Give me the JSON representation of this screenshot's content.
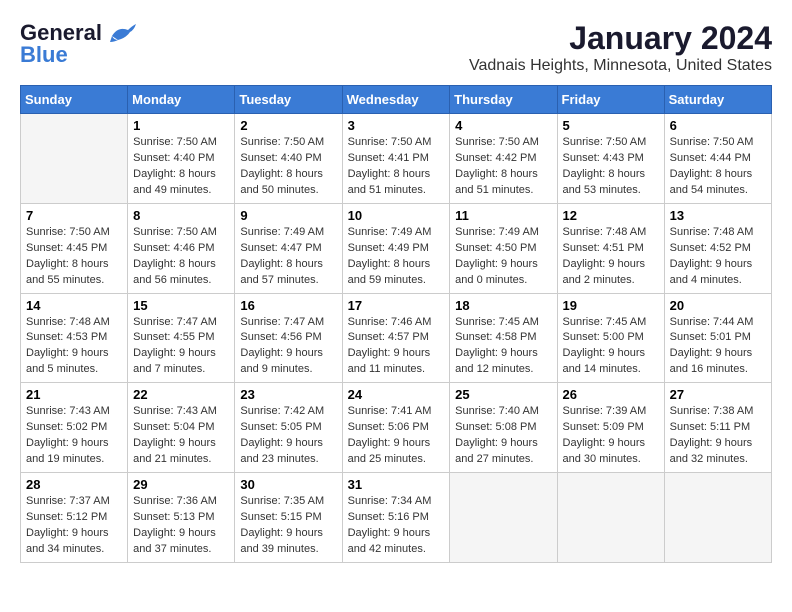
{
  "header": {
    "logo": {
      "part1": "General",
      "part2": "Blue"
    },
    "month": "January 2024",
    "location": "Vadnais Heights, Minnesota, United States"
  },
  "weekdays": [
    "Sunday",
    "Monday",
    "Tuesday",
    "Wednesday",
    "Thursday",
    "Friday",
    "Saturday"
  ],
  "weeks": [
    [
      {
        "day": "",
        "empty": true
      },
      {
        "day": "1",
        "sunrise": "Sunrise: 7:50 AM",
        "sunset": "Sunset: 4:40 PM",
        "daylight": "Daylight: 8 hours and 49 minutes."
      },
      {
        "day": "2",
        "sunrise": "Sunrise: 7:50 AM",
        "sunset": "Sunset: 4:40 PM",
        "daylight": "Daylight: 8 hours and 50 minutes."
      },
      {
        "day": "3",
        "sunrise": "Sunrise: 7:50 AM",
        "sunset": "Sunset: 4:41 PM",
        "daylight": "Daylight: 8 hours and 51 minutes."
      },
      {
        "day": "4",
        "sunrise": "Sunrise: 7:50 AM",
        "sunset": "Sunset: 4:42 PM",
        "daylight": "Daylight: 8 hours and 51 minutes."
      },
      {
        "day": "5",
        "sunrise": "Sunrise: 7:50 AM",
        "sunset": "Sunset: 4:43 PM",
        "daylight": "Daylight: 8 hours and 53 minutes."
      },
      {
        "day": "6",
        "sunrise": "Sunrise: 7:50 AM",
        "sunset": "Sunset: 4:44 PM",
        "daylight": "Daylight: 8 hours and 54 minutes."
      }
    ],
    [
      {
        "day": "7",
        "sunrise": "Sunrise: 7:50 AM",
        "sunset": "Sunset: 4:45 PM",
        "daylight": "Daylight: 8 hours and 55 minutes."
      },
      {
        "day": "8",
        "sunrise": "Sunrise: 7:50 AM",
        "sunset": "Sunset: 4:46 PM",
        "daylight": "Daylight: 8 hours and 56 minutes."
      },
      {
        "day": "9",
        "sunrise": "Sunrise: 7:49 AM",
        "sunset": "Sunset: 4:47 PM",
        "daylight": "Daylight: 8 hours and 57 minutes."
      },
      {
        "day": "10",
        "sunrise": "Sunrise: 7:49 AM",
        "sunset": "Sunset: 4:49 PM",
        "daylight": "Daylight: 8 hours and 59 minutes."
      },
      {
        "day": "11",
        "sunrise": "Sunrise: 7:49 AM",
        "sunset": "Sunset: 4:50 PM",
        "daylight": "Daylight: 9 hours and 0 minutes."
      },
      {
        "day": "12",
        "sunrise": "Sunrise: 7:48 AM",
        "sunset": "Sunset: 4:51 PM",
        "daylight": "Daylight: 9 hours and 2 minutes."
      },
      {
        "day": "13",
        "sunrise": "Sunrise: 7:48 AM",
        "sunset": "Sunset: 4:52 PM",
        "daylight": "Daylight: 9 hours and 4 minutes."
      }
    ],
    [
      {
        "day": "14",
        "sunrise": "Sunrise: 7:48 AM",
        "sunset": "Sunset: 4:53 PM",
        "daylight": "Daylight: 9 hours and 5 minutes."
      },
      {
        "day": "15",
        "sunrise": "Sunrise: 7:47 AM",
        "sunset": "Sunset: 4:55 PM",
        "daylight": "Daylight: 9 hours and 7 minutes."
      },
      {
        "day": "16",
        "sunrise": "Sunrise: 7:47 AM",
        "sunset": "Sunset: 4:56 PM",
        "daylight": "Daylight: 9 hours and 9 minutes."
      },
      {
        "day": "17",
        "sunrise": "Sunrise: 7:46 AM",
        "sunset": "Sunset: 4:57 PM",
        "daylight": "Daylight: 9 hours and 11 minutes."
      },
      {
        "day": "18",
        "sunrise": "Sunrise: 7:45 AM",
        "sunset": "Sunset: 4:58 PM",
        "daylight": "Daylight: 9 hours and 12 minutes."
      },
      {
        "day": "19",
        "sunrise": "Sunrise: 7:45 AM",
        "sunset": "Sunset: 5:00 PM",
        "daylight": "Daylight: 9 hours and 14 minutes."
      },
      {
        "day": "20",
        "sunrise": "Sunrise: 7:44 AM",
        "sunset": "Sunset: 5:01 PM",
        "daylight": "Daylight: 9 hours and 16 minutes."
      }
    ],
    [
      {
        "day": "21",
        "sunrise": "Sunrise: 7:43 AM",
        "sunset": "Sunset: 5:02 PM",
        "daylight": "Daylight: 9 hours and 19 minutes."
      },
      {
        "day": "22",
        "sunrise": "Sunrise: 7:43 AM",
        "sunset": "Sunset: 5:04 PM",
        "daylight": "Daylight: 9 hours and 21 minutes."
      },
      {
        "day": "23",
        "sunrise": "Sunrise: 7:42 AM",
        "sunset": "Sunset: 5:05 PM",
        "daylight": "Daylight: 9 hours and 23 minutes."
      },
      {
        "day": "24",
        "sunrise": "Sunrise: 7:41 AM",
        "sunset": "Sunset: 5:06 PM",
        "daylight": "Daylight: 9 hours and 25 minutes."
      },
      {
        "day": "25",
        "sunrise": "Sunrise: 7:40 AM",
        "sunset": "Sunset: 5:08 PM",
        "daylight": "Daylight: 9 hours and 27 minutes."
      },
      {
        "day": "26",
        "sunrise": "Sunrise: 7:39 AM",
        "sunset": "Sunset: 5:09 PM",
        "daylight": "Daylight: 9 hours and 30 minutes."
      },
      {
        "day": "27",
        "sunrise": "Sunrise: 7:38 AM",
        "sunset": "Sunset: 5:11 PM",
        "daylight": "Daylight: 9 hours and 32 minutes."
      }
    ],
    [
      {
        "day": "28",
        "sunrise": "Sunrise: 7:37 AM",
        "sunset": "Sunset: 5:12 PM",
        "daylight": "Daylight: 9 hours and 34 minutes."
      },
      {
        "day": "29",
        "sunrise": "Sunrise: 7:36 AM",
        "sunset": "Sunset: 5:13 PM",
        "daylight": "Daylight: 9 hours and 37 minutes."
      },
      {
        "day": "30",
        "sunrise": "Sunrise: 7:35 AM",
        "sunset": "Sunset: 5:15 PM",
        "daylight": "Daylight: 9 hours and 39 minutes."
      },
      {
        "day": "31",
        "sunrise": "Sunrise: 7:34 AM",
        "sunset": "Sunset: 5:16 PM",
        "daylight": "Daylight: 9 hours and 42 minutes."
      },
      {
        "day": "",
        "empty": true
      },
      {
        "day": "",
        "empty": true
      },
      {
        "day": "",
        "empty": true
      }
    ]
  ]
}
